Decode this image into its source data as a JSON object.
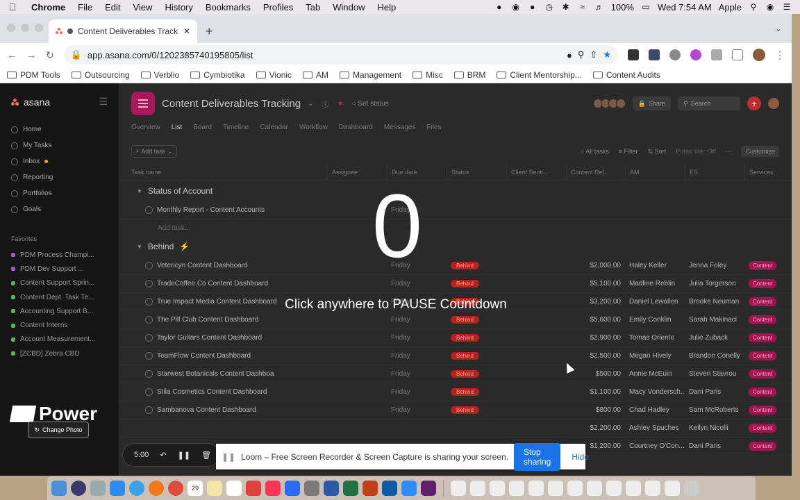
{
  "menubar": {
    "app": "Chrome",
    "items": [
      "File",
      "Edit",
      "View",
      "History",
      "Bookmarks",
      "Profiles",
      "Tab",
      "Window",
      "Help"
    ],
    "battery": "100%",
    "datetime": "Wed 7:54 AM",
    "user": "Apple"
  },
  "browser": {
    "tab_title": "Content Deliverables Tracking",
    "url": "app.asana.com/0/1202385740195805/list",
    "bookmarks": [
      "PDM Tools",
      "Outsourcing",
      "Verblio",
      "Cymbiotika",
      "Vionic",
      "AM",
      "Management",
      "Misc",
      "BRM",
      "Client Mentorship...",
      "Content Audits"
    ]
  },
  "asana": {
    "logo": "asana",
    "nav": [
      "Home",
      "My Tasks",
      "Inbox",
      "Reporting",
      "Portfolios",
      "Goals"
    ],
    "favorites_label": "Favorites",
    "favorites": [
      "PDM Process Champi...",
      "PDM Dev Support ...",
      "Content Support Sprin...",
      "Content Dept. Task Te...",
      "Accounting Support B...",
      "Content Interns",
      "Account Measurement...",
      "[ZCBD] Zebra CBD"
    ],
    "project_title": "Content Deliverables Tracking",
    "set_status": "Set status",
    "share": "Share",
    "search": "Search",
    "tabs": [
      "Overview",
      "List",
      "Board",
      "Timeline",
      "Calendar",
      "Workflow",
      "Dashboard",
      "Messages",
      "Files"
    ],
    "active_tab": "List",
    "add_task": "+ Add task",
    "all_tasks": "All tasks",
    "filter": "Filter",
    "sort": "Sort",
    "public_link": "Public link: Off",
    "customize": "Customize",
    "columns": [
      "Task name",
      "Assignee",
      "Due date",
      "Status",
      "Client Senti...",
      "Content Rel...",
      "AM",
      "ES",
      "Services"
    ],
    "section1": "Status of Account",
    "section1_rows": [
      {
        "name": "Monthly Report - Content Accounts",
        "due": "Friday"
      }
    ],
    "add_task_row": "Add task...",
    "section2": "Behind",
    "rows": [
      {
        "name": "Vetericyn Content Dashboard",
        "due": "Friday",
        "status": "Behind",
        "amount": "$2,000.00",
        "am": "Haley Keller",
        "es": "Jenna Foley",
        "service": "Content"
      },
      {
        "name": "TradeCoffee.Co Content Dashboard",
        "due": "Friday",
        "status": "Behind",
        "amount": "$5,100.00",
        "am": "Madline Reblin",
        "es": "Julia Torgerson",
        "service": "Content"
      },
      {
        "name": "True Impact Media Content Dashboard",
        "due": "Friday",
        "status": "Behind",
        "amount": "$3,200.00",
        "am": "Daniel Lewallen",
        "es": "Brooke Neuman",
        "service": "Content"
      },
      {
        "name": "The Pill Club Content Dashboard",
        "due": "Friday",
        "status": "Behind",
        "amount": "$5,600.00",
        "am": "Emily Conklin",
        "es": "Sarah Makinaci",
        "service": "Content"
      },
      {
        "name": "Taylor Guitars Content Dashboard",
        "due": "Friday",
        "status": "Behind",
        "amount": "$2,900.00",
        "am": "Tomas Oriente",
        "es": "Julie Zuback",
        "service": "Content"
      },
      {
        "name": "TeamFlow Content Dashboard",
        "due": "Friday",
        "status": "Behind",
        "amount": "$2,500.00",
        "am": "Megan Hively",
        "es": "Brandon Conelly",
        "service": "Content"
      },
      {
        "name": "Starwest Botanicals Content Dashboa",
        "due": "Friday",
        "status": "Behind",
        "amount": "$500.00",
        "am": "Annie McEuin",
        "es": "Steven Stavrou",
        "service": "Content"
      },
      {
        "name": "Stila Cosmetics Content Dashboard",
        "due": "Friday",
        "status": "Behind",
        "amount": "$1,100.00",
        "am": "Macy Vondersch...",
        "es": "Dani Paris",
        "service": "Content"
      },
      {
        "name": "Sambanova Content Dashboard",
        "due": "Friday",
        "status": "Behind",
        "amount": "$800.00",
        "am": "Chad Hadley",
        "es": "Sam McRoberts",
        "service": "Content"
      },
      {
        "name": "",
        "due": "",
        "status": "",
        "amount": "$2,200.00",
        "am": "Ashley Spuches",
        "es": "Kellyn Nicolli",
        "service": "Content"
      },
      {
        "name": "",
        "due": "",
        "status": "",
        "amount": "$1,200.00",
        "am": "Courtney O'Con...",
        "es": "Dani Paris",
        "service": "Content"
      }
    ]
  },
  "overlay": {
    "countdown": "0",
    "message": "Click anywhere to PAUSE Countdown"
  },
  "webcam": {
    "logo_text": "Power",
    "change_photo": "Change Photo"
  },
  "loom": {
    "timer": "5:00",
    "sharing_message": "Loom – Free Screen Recorder & Screen Capture is sharing your screen.",
    "stop_sharing": "Stop sharing",
    "hide": "Hide"
  },
  "dock": {
    "calendar_date": "29"
  }
}
